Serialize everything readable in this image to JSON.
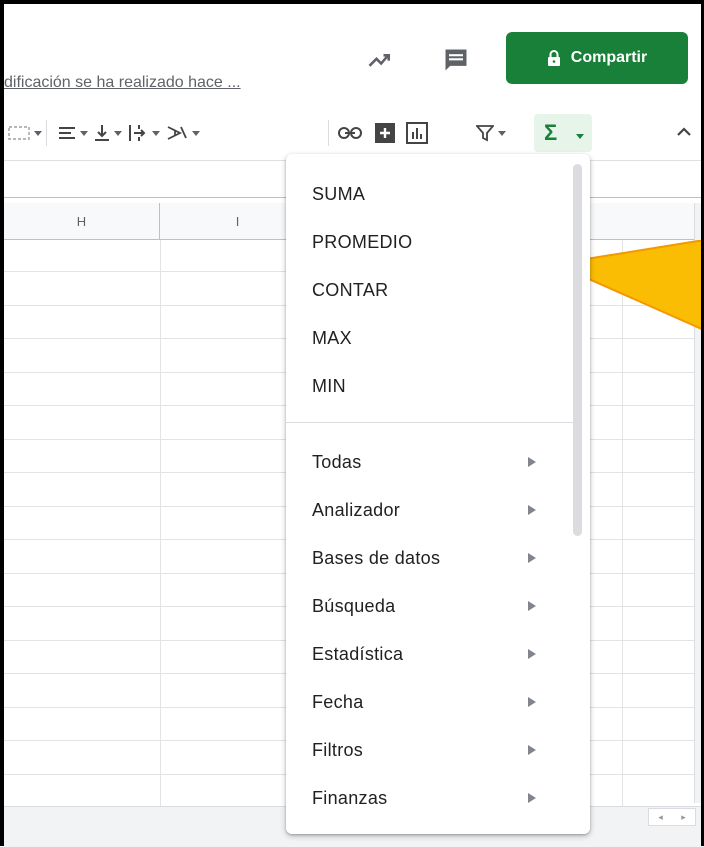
{
  "header": {
    "last_edit_text": "dificación se ha realizado hace ...",
    "share_label": "Compartir",
    "icons": [
      "trending-up-icon",
      "comment-icon",
      "lock-icon"
    ],
    "share_color": "#188038"
  },
  "toolbar": {
    "icons": [
      "merge-cells-icon",
      "horizontal-align-icon",
      "vertical-align-icon",
      "text-wrap-icon",
      "text-rotation-icon",
      "link-icon",
      "insert-comment-icon",
      "insert-chart-icon",
      "filter-icon",
      "functions-icon",
      "collapse-icon"
    ],
    "functions_symbol": "Σ"
  },
  "grid": {
    "columns": [
      "H",
      "I"
    ]
  },
  "functions_menu": {
    "quick_functions": [
      "SUMA",
      "PROMEDIO",
      "CONTAR",
      "MAX",
      "MIN"
    ],
    "categories": [
      "Todas",
      "Analizador",
      "Bases de datos",
      "Búsqueda",
      "Estadística",
      "Fecha",
      "Filtros",
      "Finanzas"
    ]
  },
  "callout_color": "#fbbc04"
}
